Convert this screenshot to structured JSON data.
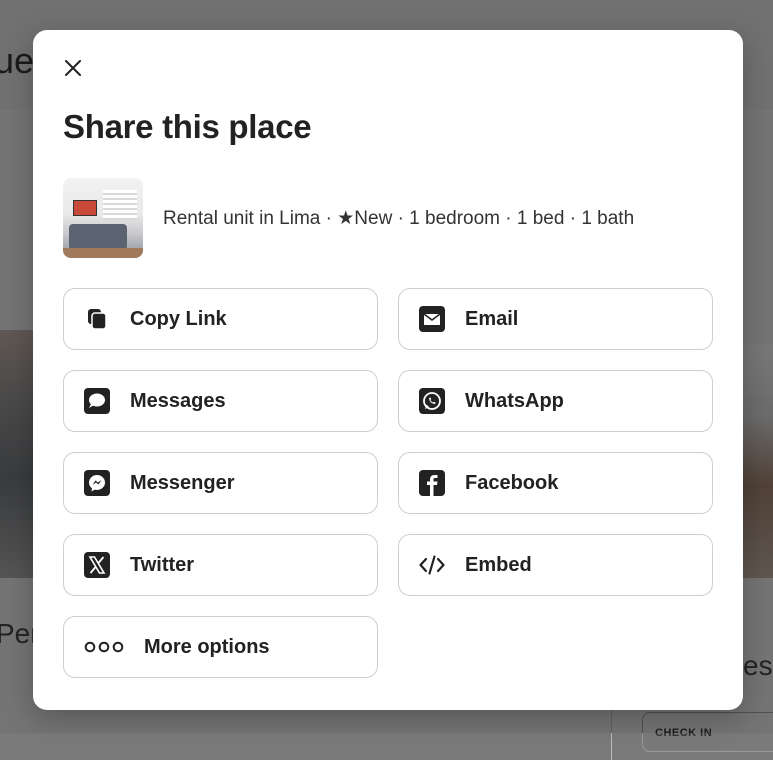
{
  "background": {
    "heading_fragment": "uel",
    "left_text_fragment": "Per",
    "right_text_fragment": "es",
    "checkin_label": "CHECK IN"
  },
  "modal": {
    "title": "Share this place",
    "listing": {
      "description": "Rental unit in Lima · ★New · 1 bedroom · 1 bed · 1 bath"
    },
    "share_options": [
      {
        "label": "Copy Link",
        "icon": "copy-icon"
      },
      {
        "label": "Email",
        "icon": "email-icon"
      },
      {
        "label": "Messages",
        "icon": "messages-icon"
      },
      {
        "label": "WhatsApp",
        "icon": "whatsapp-icon"
      },
      {
        "label": "Messenger",
        "icon": "messenger-icon"
      },
      {
        "label": "Facebook",
        "icon": "facebook-icon"
      },
      {
        "label": "Twitter",
        "icon": "twitter-x-icon"
      },
      {
        "label": "Embed",
        "icon": "embed-icon"
      },
      {
        "label": "More options",
        "icon": "more-options-icon"
      }
    ]
  },
  "colors": {
    "text_primary": "#222222",
    "border": "#cfcfcf",
    "overlay": "rgba(0,0,0,0.48)"
  }
}
